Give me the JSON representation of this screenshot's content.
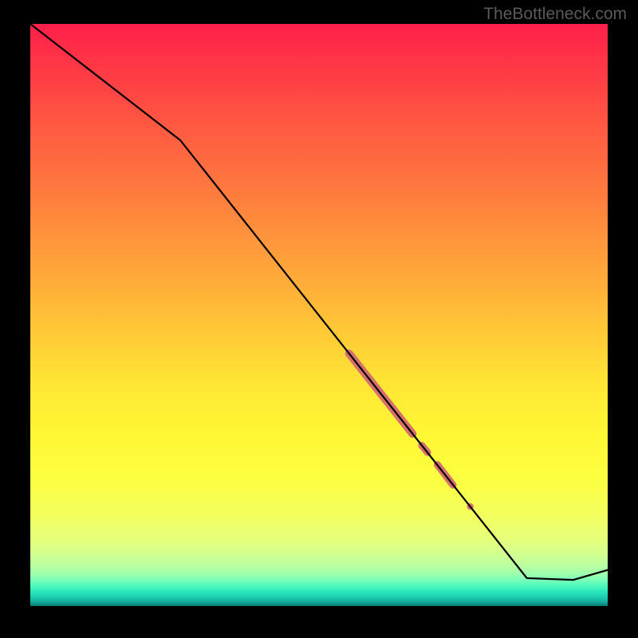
{
  "watermark": "TheBottleneck.com",
  "chart_data": {
    "type": "line",
    "title": "",
    "xlabel": "",
    "ylabel": "",
    "xlim": [
      0,
      100
    ],
    "ylim": [
      0,
      100
    ],
    "grid": false,
    "line_points": [
      {
        "x": 0,
        "y": 100
      },
      {
        "x": 26,
        "y": 80
      },
      {
        "x": 86,
        "y": 4.8
      },
      {
        "x": 94,
        "y": 4.5
      },
      {
        "x": 100,
        "y": 6.2
      }
    ],
    "highlight_segments": [
      {
        "x1": 55.2,
        "y1": 43.4,
        "x2": 66.2,
        "y2": 29.6,
        "w": 10
      },
      {
        "x1": 67.8,
        "y1": 27.6,
        "x2": 68.8,
        "y2": 26.4,
        "w": 9
      },
      {
        "x1": 70.5,
        "y1": 24.3,
        "x2": 73.2,
        "y2": 20.8,
        "w": 9
      }
    ],
    "highlight_points": [
      {
        "x": 76.2,
        "y": 17.1,
        "r": 4.2
      }
    ],
    "highlight_color": "#d6706f",
    "line_color": "#000000"
  }
}
